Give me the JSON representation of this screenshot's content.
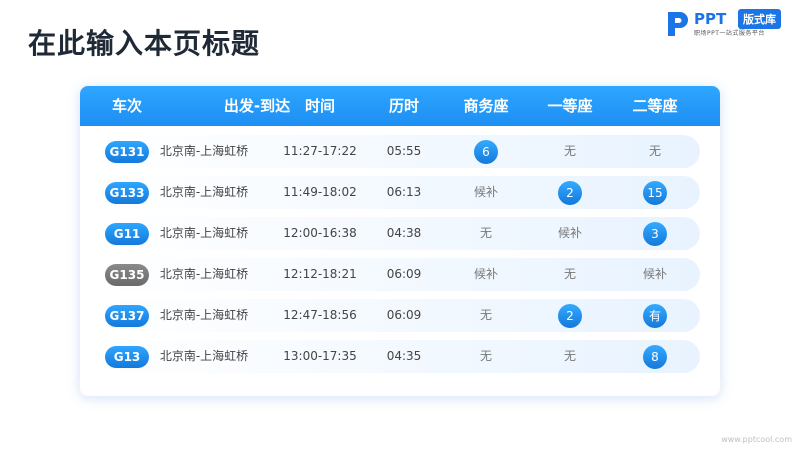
{
  "page": {
    "title": "在此输入本页标题"
  },
  "logo": {
    "word": "PPT",
    "badge": "版式库",
    "sub": "职场PPT一站式服务平台"
  },
  "table": {
    "headers": [
      "车次",
      "出发-到达",
      "时间",
      "历时",
      "商务座",
      "一等座",
      "二等座"
    ],
    "rows": [
      {
        "train": "G131",
        "train_style": "blue",
        "route": "北京南-上海虹桥",
        "time": "11:27-17:22",
        "duration": "05:55",
        "business": {
          "text": "6",
          "badge": true
        },
        "first": {
          "text": "无",
          "badge": false
        },
        "second": {
          "text": "无",
          "badge": false
        }
      },
      {
        "train": "G133",
        "train_style": "blue",
        "route": "北京南-上海虹桥",
        "time": "11:49-18:02",
        "duration": "06:13",
        "business": {
          "text": "候补",
          "badge": false
        },
        "first": {
          "text": "2",
          "badge": true
        },
        "second": {
          "text": "15",
          "badge": true
        }
      },
      {
        "train": "G11",
        "train_style": "blue",
        "route": "北京南-上海虹桥",
        "time": "12:00-16:38",
        "duration": "04:38",
        "business": {
          "text": "无",
          "badge": false
        },
        "first": {
          "text": "候补",
          "badge": false
        },
        "second": {
          "text": "3",
          "badge": true
        }
      },
      {
        "train": "G135",
        "train_style": "gray",
        "route": "北京南-上海虹桥",
        "time": "12:12-18:21",
        "duration": "06:09",
        "business": {
          "text": "候补",
          "badge": false
        },
        "first": {
          "text": "无",
          "badge": false
        },
        "second": {
          "text": "候补",
          "badge": false
        }
      },
      {
        "train": "G137",
        "train_style": "blue",
        "route": "北京南-上海虹桥",
        "time": "12:47-18:56",
        "duration": "06:09",
        "business": {
          "text": "无",
          "badge": false
        },
        "first": {
          "text": "2",
          "badge": true
        },
        "second": {
          "text": "有",
          "badge": true
        }
      },
      {
        "train": "G13",
        "train_style": "blue",
        "route": "北京南-上海虹桥",
        "time": "13:00-17:35",
        "duration": "04:35",
        "business": {
          "text": "无",
          "badge": false
        },
        "first": {
          "text": "无",
          "badge": false
        },
        "second": {
          "text": "8",
          "badge": true
        }
      }
    ]
  },
  "watermark": "www.pptcool.com",
  "colors": {
    "accent": "#1d8ff3",
    "train_gray": "#7a7a7a",
    "title": "#1f2a36"
  }
}
